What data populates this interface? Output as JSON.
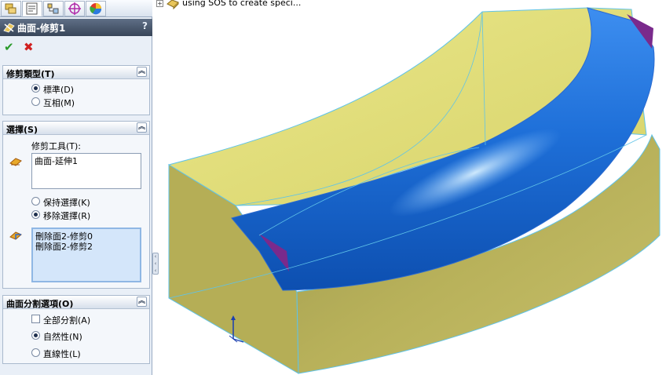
{
  "property_manager": {
    "tabs": [
      {
        "name": "feature-manager-tab-icon"
      },
      {
        "name": "property-manager-tab-icon"
      },
      {
        "name": "configuration-manager-tab-icon"
      },
      {
        "name": "dimxpert-manager-tab-icon"
      },
      {
        "name": "display-manager-tab-icon"
      }
    ],
    "title": "曲面-修剪1",
    "help": "?",
    "trim_type": {
      "header": "修剪類型(T)",
      "options": [
        {
          "label": "標準(D)",
          "selected": true
        },
        {
          "label": "互相(M)",
          "selected": false
        }
      ]
    },
    "selections": {
      "header": "選擇(S)",
      "trim_tool_label": "修剪工具(T):",
      "trim_tool_value": "曲面-延伸1",
      "keep_label": "保持選擇(K)",
      "remove_label": "移除選擇(R)",
      "remove_selected": true,
      "pieces": [
        "刪除面2-修剪0",
        "刪除面2-修剪2"
      ]
    },
    "split_options": {
      "header": "曲面分割選項(O)",
      "split_all_label": "全部分割(A)",
      "split_all_checked": false,
      "natural_label": "自然性(N)",
      "linear_label": "直線性(L)",
      "natural_selected": true
    }
  },
  "graphics": {
    "tree_flyout_label": "using SOS to create speci...",
    "colors": {
      "surface_yellow": "#e6e27a",
      "surface_olive": "#b3ac58",
      "trimmed_blue": "#1a73e0",
      "edge_purple": "#7a2a8c",
      "edge_highlight": "#5fc3e8"
    }
  }
}
